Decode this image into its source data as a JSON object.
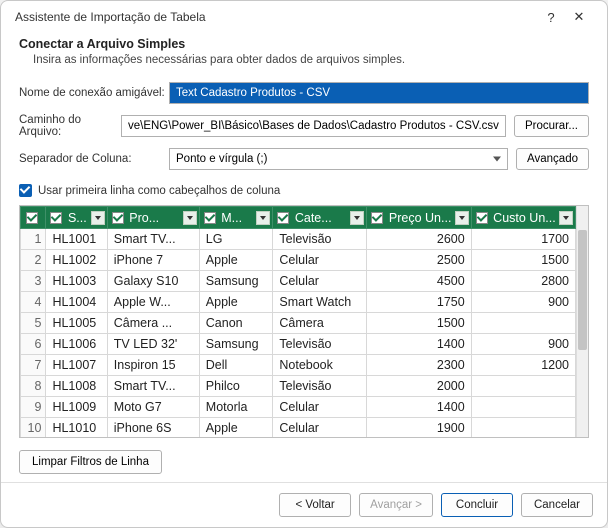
{
  "titlebar": {
    "title": "Assistente de Importação de Tabela",
    "help": "?",
    "close": "✕"
  },
  "header": {
    "title": "Conectar a Arquivo Simples",
    "subtitle": "Insira as informações necessárias para obter dados de arquivos simples."
  },
  "form": {
    "friendly_label": "Nome de conexão amigável:",
    "friendly_value": "Text Cadastro Produtos - CSV",
    "path_label": "Caminho do Arquivo:",
    "path_value": "ve\\ENG\\Power_BI\\Básico\\Bases de Dados\\Cadastro Produtos - CSV.csv",
    "browse_label": "Procurar...",
    "sep_label": "Separador de Coluna:",
    "sep_value": "Ponto e vírgula (;)",
    "advanced_label": "Avançado"
  },
  "checkbox": {
    "label": "Usar primeira linha como cabeçalhos de coluna"
  },
  "columns": [
    "S...",
    "Pro...",
    "M...",
    "Cate...",
    "Preço Un...",
    "Custo Un..."
  ],
  "col_widths": [
    "60px",
    "90px",
    "72px",
    "92px",
    "102px",
    "102px"
  ],
  "rows": [
    {
      "n": "1",
      "c": [
        "HL1001",
        "Smart TV...",
        "LG",
        "Televisão",
        "2600",
        "1700"
      ]
    },
    {
      "n": "2",
      "c": [
        "HL1002",
        "iPhone 7",
        "Apple",
        "Celular",
        "2500",
        "1500"
      ]
    },
    {
      "n": "3",
      "c": [
        "HL1003",
        "Galaxy S10",
        "Samsung",
        "Celular",
        "4500",
        "2800"
      ]
    },
    {
      "n": "4",
      "c": [
        "HL1004",
        "Apple W...",
        "Apple",
        "Smart Watch",
        "1750",
        "900"
      ]
    },
    {
      "n": "5",
      "c": [
        "HL1005",
        "Câmera ...",
        "Canon",
        "Câmera",
        "1500",
        ""
      ]
    },
    {
      "n": "6",
      "c": [
        "HL1006",
        "TV LED 32'",
        "Samsung",
        "Televisão",
        "1400",
        "900"
      ]
    },
    {
      "n": "7",
      "c": [
        "HL1007",
        "Inspiron 15",
        "Dell",
        "Notebook",
        "2300",
        "1200"
      ]
    },
    {
      "n": "8",
      "c": [
        "HL1008",
        "Smart TV...",
        "Philco",
        "Televisão",
        "2000",
        ""
      ]
    },
    {
      "n": "9",
      "c": [
        "HL1009",
        "Moto G7",
        "Motorla",
        "Celular",
        "1400",
        ""
      ]
    },
    {
      "n": "10",
      "c": [
        "HL1010",
        "iPhone 6S",
        "Apple",
        "Celular",
        "1900",
        ""
      ]
    }
  ],
  "below": {
    "clear_filters": "Limpar Filtros de Linha"
  },
  "footer": {
    "back": "< Voltar",
    "next": "Avançar >",
    "finish": "Concluir",
    "cancel": "Cancelar"
  }
}
